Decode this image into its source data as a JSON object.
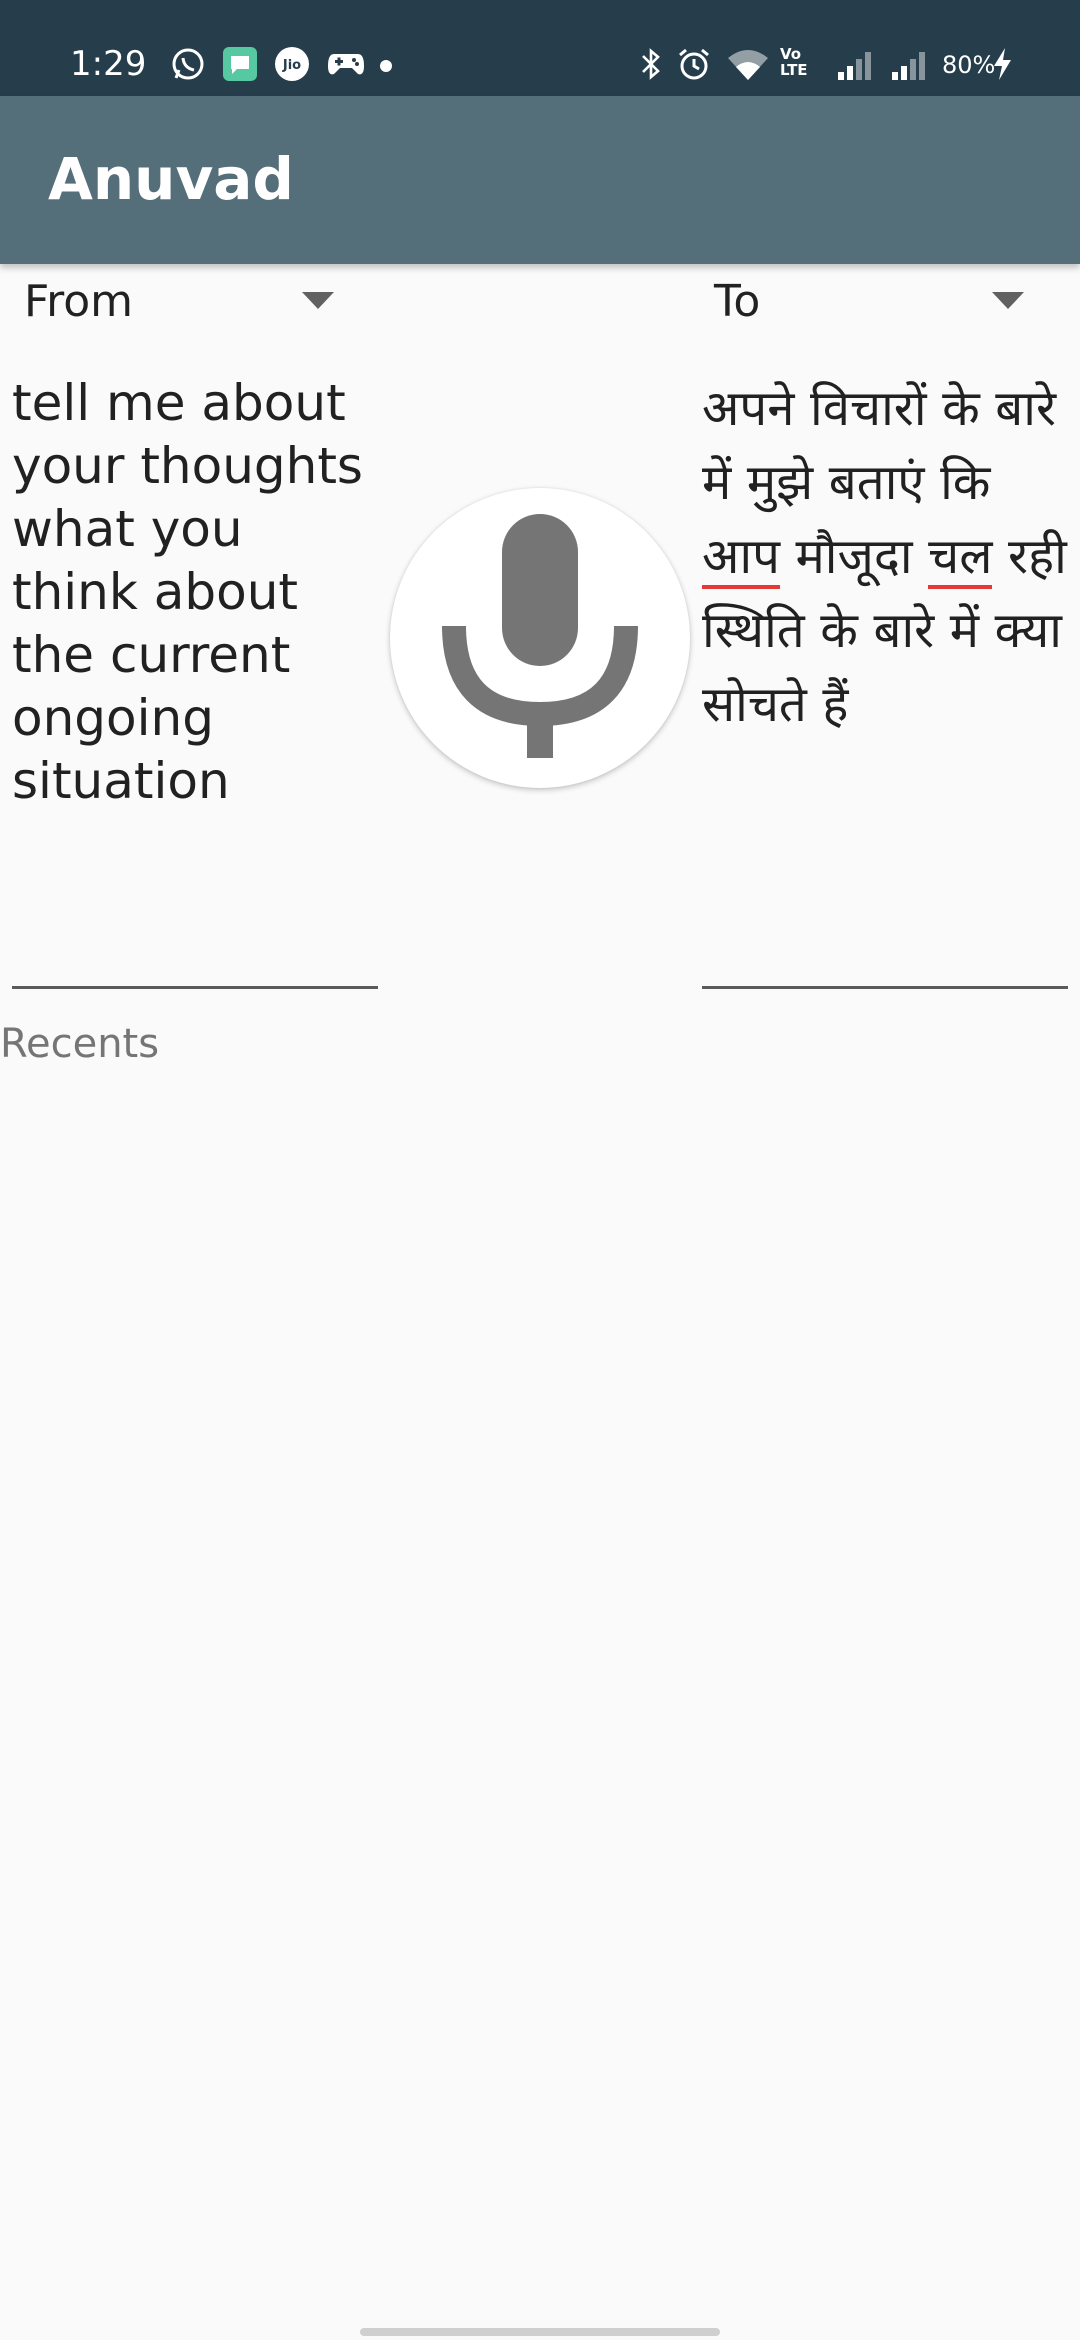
{
  "status_bar": {
    "time": "1:29",
    "battery_percent": "80%",
    "notification_icons": [
      "whatsapp-icon",
      "messages-icon",
      "jio-icon",
      "game-controller-icon",
      "dot-icon"
    ],
    "system_icons": [
      "bluetooth-icon",
      "alarm-icon",
      "wifi-icon",
      "volte-icon",
      "signal-icon",
      "signal-icon",
      "battery-charging-icon"
    ],
    "jio_text": "Jio",
    "volte_text_top": "Vo",
    "volte_text_bottom": "LTE",
    "colors": {
      "background": "#263d4b"
    }
  },
  "app_bar": {
    "title": "Anuvad",
    "colors": {
      "background": "#546e7a"
    }
  },
  "from_spinner": {
    "label": "From"
  },
  "to_spinner": {
    "label": "To"
  },
  "source": {
    "text": "tell me about your thoughts what you think about the current ongoing situation"
  },
  "translation": {
    "text_before": "अपने विचारों के बारे में मुझे बताएं कि ",
    "word_flagged_1": "आप",
    "text_middle": " मौजूदा ",
    "word_flagged_2": "चल",
    "text_after": " रही स्थिति के बारे में क्या सोचते हैं"
  },
  "mic": {
    "icon": "microphone-icon"
  },
  "recents": {
    "label": "Recents",
    "items": []
  },
  "colors": {
    "spell_underline": "#e53935",
    "mic_gray": "#757575"
  }
}
